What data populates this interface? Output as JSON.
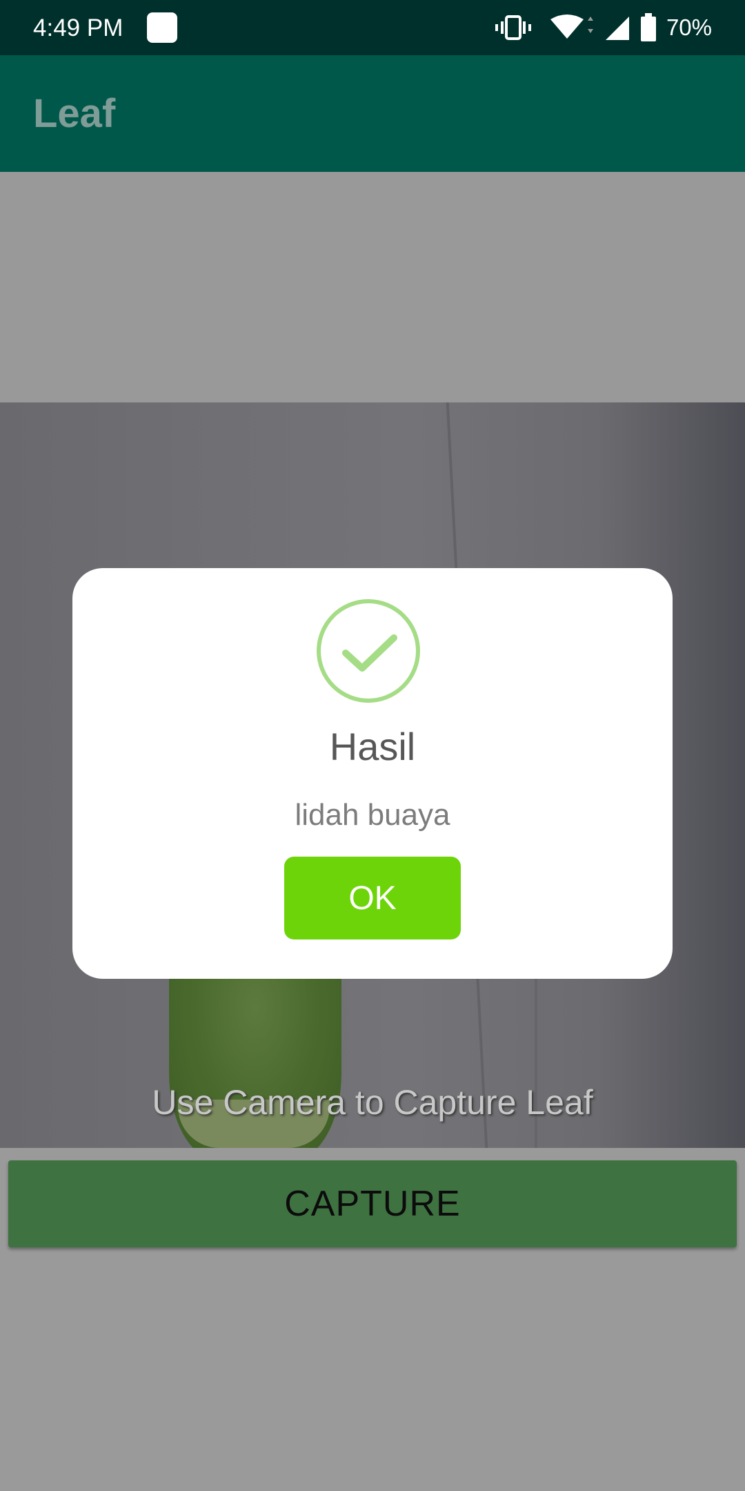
{
  "status_bar": {
    "time": "4:49 PM",
    "battery": "70%",
    "icons": [
      "notification-icon",
      "vibrate-icon",
      "wifi-icon",
      "signal-icon",
      "battery-icon"
    ]
  },
  "app_bar": {
    "title": "Leaf"
  },
  "camera": {
    "hint": "Use Camera to Capture Leaf"
  },
  "capture_button": {
    "label": "CAPTURE"
  },
  "dialog": {
    "title": "Hasil",
    "content": "lidah buaya",
    "confirm_label": "OK",
    "icon": "success-check-icon",
    "accent_color": "#6dd40a",
    "check_color": "#a5dc86"
  }
}
